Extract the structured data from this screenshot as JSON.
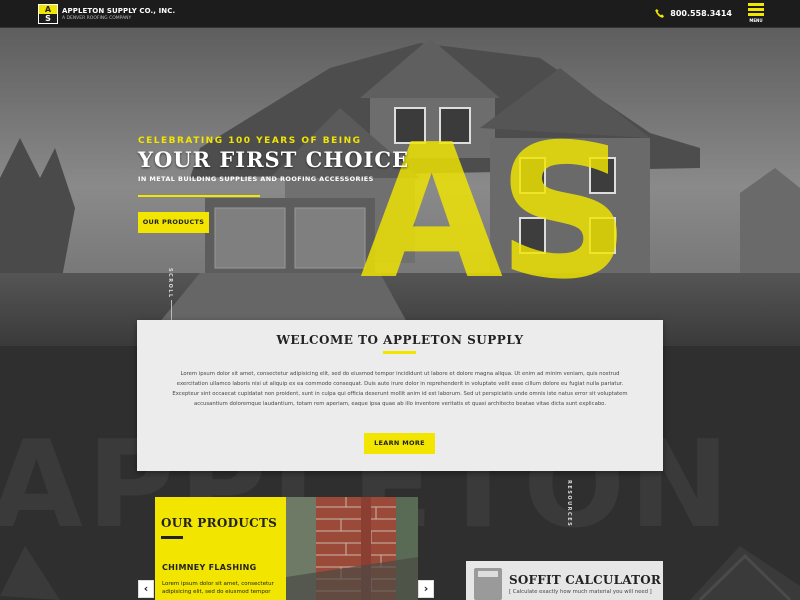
{
  "header": {
    "logo_top": "A",
    "logo_bottom": "S",
    "brand_name": "APPLETON SUPPLY CO., INC.",
    "brand_sub": "A DENVER ROOFING COMPANY",
    "phone": "800.558.3414",
    "menu_label": "MENU"
  },
  "hero": {
    "kicker_pre": "CELEBRATING ",
    "kicker_num": "100",
    "kicker_post": " YEARS OF BEING",
    "headline": "YOUR FIRST CHOICE",
    "subhead": "IN METAL BUILDING SUPPLIES AND ROOFING ACCESSORIES",
    "cta": "OUR PRODUCTS",
    "overlay_letters": "AS",
    "scroll_label": "SCROLL"
  },
  "welcome": {
    "title": "WELCOME TO APPLETON SUPPLY",
    "body": "Lorem ipsum dolor sit amet, consectetur adipisicing elit, sed do eiusmod tempor incididunt ut labore et dolore magna aliqua. Ut enim ad minim veniam, quis nostrud exercitation ullamco laboris nisi ut aliquip ex ea commodo consequat. Duis aute irure dolor in reprehenderit in voluptate velit esse cillum dolore eu fugiat nulla pariatur. Excepteur sint occaecat cupidatat non proident, sunt in culpa qui officia deserunt mollit anim id est laborum. Sed ut perspiciatis unde omnis iste natus error sit voluptatem accusantium doloremque laudantium, totam rem aperiam, eaque ipsa quae ab illo inventore veritatis et quasi architecto beatae vitae dicta sunt explicabo.",
    "cta": "LEARN MORE"
  },
  "background_word": "APPLETON",
  "resources_label": "RESOURCES",
  "products": {
    "title": "OUR PRODUCTS",
    "item": "CHIMNEY FLASHING",
    "desc": "Lorem ipsum dolor sit amet, consectetur adipisicing elit, sed do eiusmod tempor",
    "prev": "‹",
    "next": "›"
  },
  "soffit": {
    "title": "SOFFIT CALCULATOR",
    "tagline": "[ Calculate exactly how much material you will need ]"
  },
  "colors": {
    "accent": "#f2e600",
    "dark": "#2f2f2f",
    "card": "#ececec"
  }
}
